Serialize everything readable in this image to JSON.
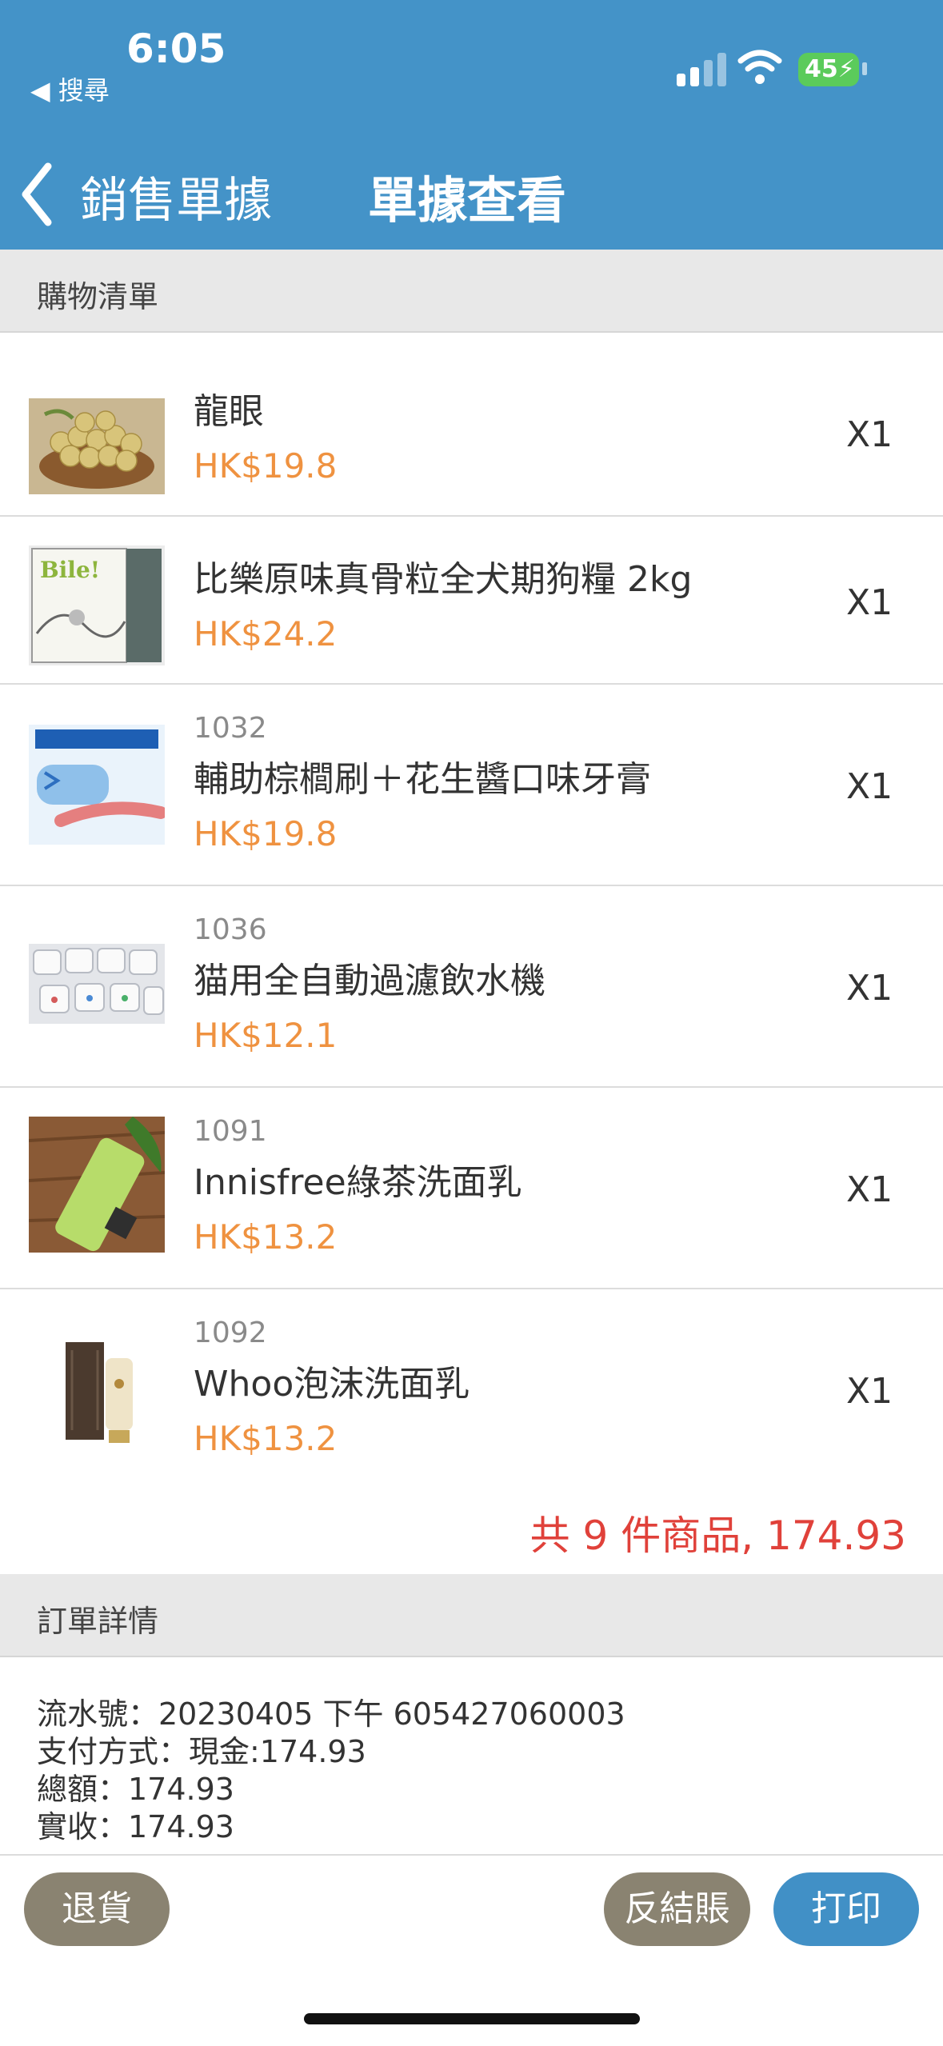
{
  "status_bar": {
    "time": "6:05",
    "back_app": "◀ 搜尋",
    "battery": "45"
  },
  "nav": {
    "back_label": "銷售單據",
    "title": "單據查看"
  },
  "shopping_list": {
    "section_title": "購物清單",
    "items": [
      {
        "sku": "",
        "name": "龍眼",
        "price": "HK$19.8",
        "qty": "X1"
      },
      {
        "sku": "",
        "name": "比樂原味真骨粒全犬期狗糧 2kg",
        "price": "HK$24.2",
        "qty": "X1"
      },
      {
        "sku": "1032",
        "name": "輔助棕櫚刷＋花生醬口味牙膏",
        "price": "HK$19.8",
        "qty": "X1"
      },
      {
        "sku": "1036",
        "name": "猫用全自動過濾飲水機",
        "price": "HK$12.1",
        "qty": "X1"
      },
      {
        "sku": "1091",
        "name": "Innisfree綠茶洗面乳",
        "price": "HK$13.2",
        "qty": "X1"
      },
      {
        "sku": "1092",
        "name": "Whoo泡沫洗面乳",
        "price": "HK$13.2",
        "qty": "X1"
      }
    ],
    "total_text": "共 9 件商品, 174.93"
  },
  "order_details": {
    "section_title": "訂單詳情",
    "serial": "流水號：20230405 下午 605427060003",
    "payment": "支付方式：現金:174.93",
    "amount": "總額：174.93",
    "received": "實收：174.93"
  },
  "actions": {
    "return_label": "退貨",
    "reverse_label": "反結賬",
    "print_label": "打印"
  }
}
